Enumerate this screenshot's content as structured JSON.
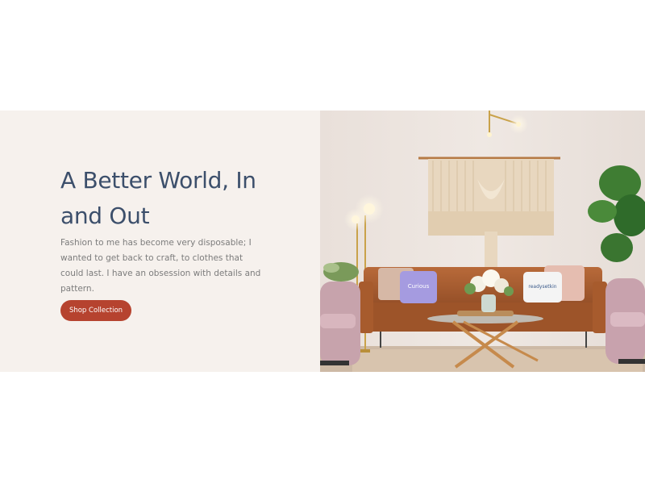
{
  "hero": {
    "title": "A Better World, In and Out",
    "description": "Fashion to me has become very disposable; I wanted to get back to craft, to clothes that could last. I have an obsession with details and pattern.",
    "cta_label": "Shop Collection",
    "image": {
      "pillow_left_text": "Curious",
      "pillow_right_text": "readysetkin"
    }
  },
  "colors": {
    "title": "#3c4f6b",
    "text": "#7c7c7c",
    "panel_bg": "#f6f1ed",
    "button_bg": "#b6432f",
    "button_text": "#ffffff"
  }
}
